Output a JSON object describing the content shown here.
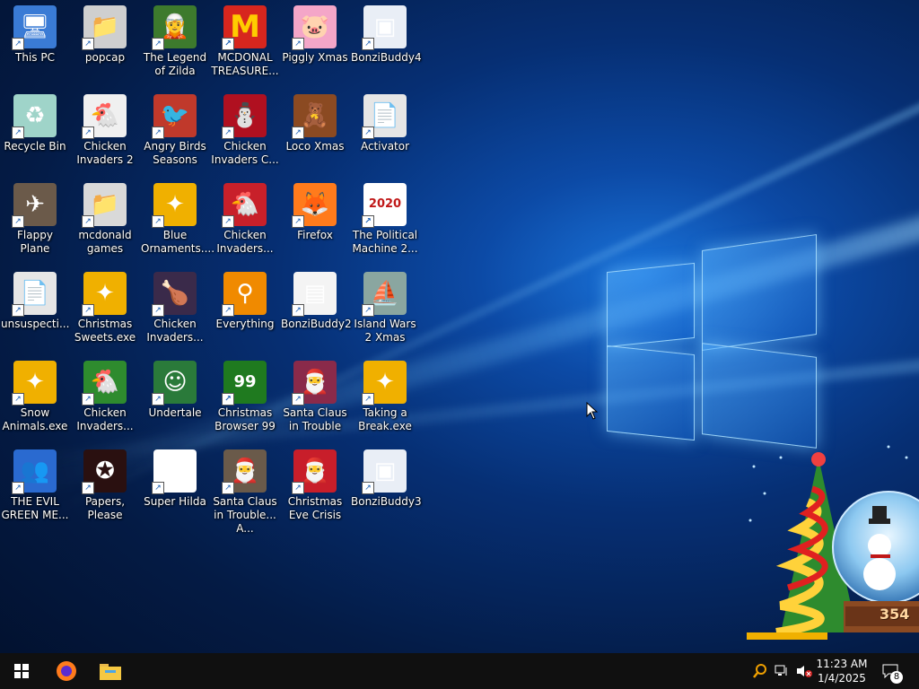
{
  "desktop": {
    "icons": [
      {
        "label": "This PC",
        "icon": "this-pc-icon",
        "glyph": "🖥",
        "color": "#3a7bd5"
      },
      {
        "label": "popcap",
        "icon": "folder-icon",
        "glyph": "📁",
        "color": "#cfcfcf"
      },
      {
        "label": "The Legend of Zilda",
        "icon": "legend-zilda-icon",
        "glyph": "🧝",
        "color": "#3d7a2d"
      },
      {
        "label": "MCDONAL TREASURE...",
        "icon": "mcdonalds-icon",
        "glyph": "M",
        "color": "#d7261e"
      },
      {
        "label": "Piggly Xmas",
        "icon": "pig-icon",
        "glyph": "🐷",
        "color": "#f4a6c8"
      },
      {
        "label": "BonziBuddy4",
        "icon": "bonzi-window-icon",
        "glyph": "▣",
        "color": "#e9eef6"
      },
      {
        "label": "Recycle Bin",
        "icon": "recycle-bin-icon",
        "glyph": "♻",
        "color": "#9fd4c9"
      },
      {
        "label": "Chicken Invaders 2",
        "icon": "chicken-icon",
        "glyph": "🐔",
        "color": "#f0f0f0"
      },
      {
        "label": "Angry Birds Seasons",
        "icon": "angry-bird-icon",
        "glyph": "🐦",
        "color": "#c0392b"
      },
      {
        "label": "Chicken Invaders C...",
        "icon": "chicken-snowman-icon",
        "glyph": "⛄",
        "color": "#b01020"
      },
      {
        "label": "Loco Xmas",
        "icon": "bear-icon",
        "glyph": "🧸",
        "color": "#8b4a22"
      },
      {
        "label": "Activator",
        "icon": "file-icon",
        "glyph": "📄",
        "color": "#e6e6e6"
      },
      {
        "label": "Flappy Plane",
        "icon": "plane-icon",
        "glyph": "✈",
        "color": "#6b5a4a"
      },
      {
        "label": "mcdonald games",
        "icon": "folder-icon",
        "glyph": "📁",
        "color": "#d9d9d9"
      },
      {
        "label": "Blue Ornaments....",
        "icon": "puzzle-icon",
        "glyph": "✦",
        "color": "#f0b000"
      },
      {
        "label": "Chicken Invaders...",
        "icon": "chicken-santa-icon",
        "glyph": "🐔",
        "color": "#c8202a"
      },
      {
        "label": "Firefox",
        "icon": "firefox-icon",
        "glyph": "🦊",
        "color": "#ff7b1c"
      },
      {
        "label": "The Political Machine 2...",
        "icon": "political-icon",
        "glyph": "2020",
        "color": "#ffffff"
      },
      {
        "label": "unsuspecti...",
        "icon": "file-icon",
        "glyph": "📄",
        "color": "#e6e6e6"
      },
      {
        "label": "Christmas Sweets.exe",
        "icon": "puzzle-icon",
        "glyph": "✦",
        "color": "#f0b000"
      },
      {
        "label": "Chicken Invaders...",
        "icon": "chicken-space-icon",
        "glyph": "🍗",
        "color": "#3a2a4a"
      },
      {
        "label": "Everything",
        "icon": "search-icon",
        "glyph": "⚲",
        "color": "#f08a00"
      },
      {
        "label": "BonziBuddy2",
        "icon": "film-icon",
        "glyph": "▤",
        "color": "#f4f4f4"
      },
      {
        "label": "Island Wars 2 Xmas",
        "icon": "island-icon",
        "glyph": "⛵",
        "color": "#8aa6a0"
      },
      {
        "label": "Snow Animals.exe",
        "icon": "puzzle-icon",
        "glyph": "✦",
        "color": "#f0b000"
      },
      {
        "label": "Chicken Invaders...",
        "icon": "chicken-green-icon",
        "glyph": "🐔",
        "color": "#2e8b2e"
      },
      {
        "label": "Undertale",
        "icon": "undertale-icon",
        "glyph": "☺",
        "color": "#2a7a3a"
      },
      {
        "label": "Christmas Browser 99",
        "icon": "xmas-tree-icon",
        "glyph": "99",
        "color": "#1f7a1f"
      },
      {
        "label": "Santa Claus in Trouble",
        "icon": "santa-icon",
        "glyph": "🎅",
        "color": "#8a2a4a"
      },
      {
        "label": "Taking a Break.exe",
        "icon": "puzzle-icon",
        "glyph": "✦",
        "color": "#f0b000"
      },
      {
        "label": "THE EVIL GREEN ME...",
        "icon": "messenger-icon",
        "glyph": "👥",
        "color": "#2a6ad0"
      },
      {
        "label": "Papers, Please",
        "icon": "papers-please-icon",
        "glyph": "✪",
        "color": "#2a1010"
      },
      {
        "label": "Super Hilda",
        "icon": "pixel-icon",
        "glyph": "▦",
        "color": "#ffffff"
      },
      {
        "label": "Santa Claus in Trouble... A...",
        "icon": "santa-icon",
        "glyph": "🎅",
        "color": "#6a5a4a"
      },
      {
        "label": "Christmas Eve Crisis",
        "icon": "santa-face-icon",
        "glyph": "🎅",
        "color": "#c81e2a"
      },
      {
        "label": "BonziBuddy3",
        "icon": "bonzi-window-icon",
        "glyph": "▣",
        "color": "#e9eef6"
      }
    ]
  },
  "taskbar": {
    "start_glyph": "⊞",
    "firefox_glyph": "●",
    "explorer_glyph": "▬",
    "tray_search_glyph": "⚲",
    "tray_network_glyph": "🖧",
    "tray_volume_glyph": "🔈",
    "time": "11:23 AM",
    "date": "1/4/2025",
    "notification_count": "8",
    "notification_glyph": "💬"
  },
  "decoration": {
    "counter": "354"
  }
}
